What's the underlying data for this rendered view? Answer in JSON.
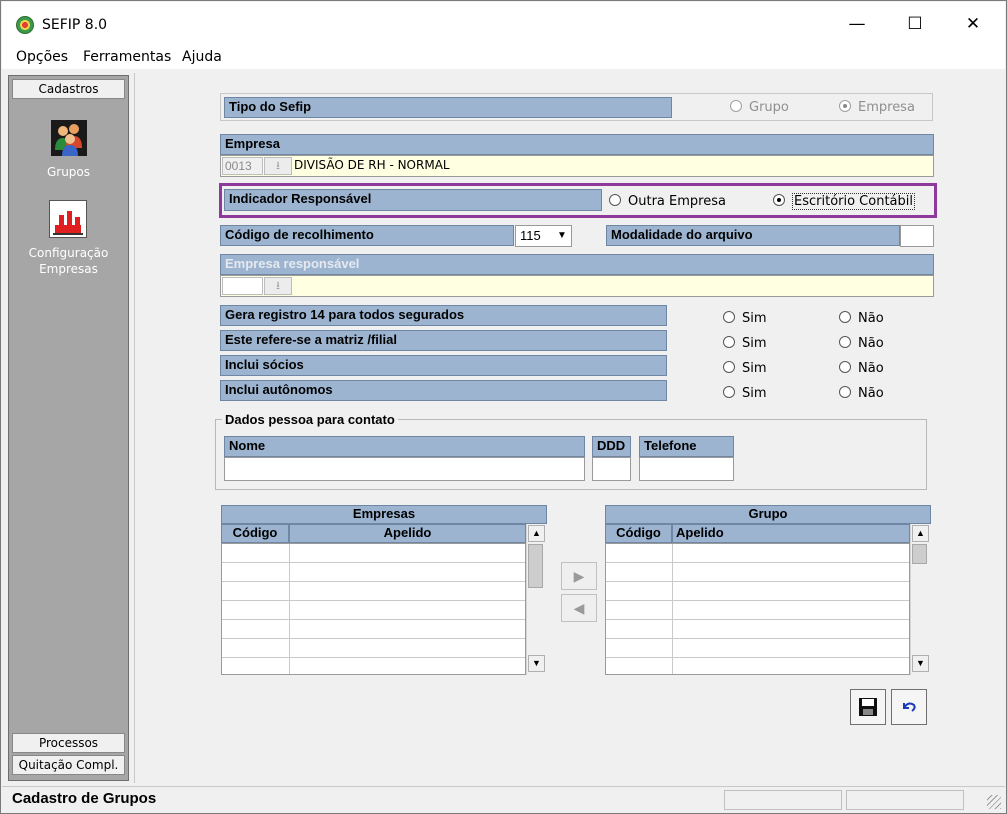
{
  "window": {
    "title": "SEFIP 8.0",
    "minimize_glyph": "—",
    "maximize_glyph": "☐",
    "close_glyph": "✕"
  },
  "menu": [
    "Opções",
    "Ferramentas",
    "Ajuda"
  ],
  "sidebar": {
    "top_tab": "Cadastros",
    "items": [
      {
        "label": "Grupos",
        "icon": "users-group-icon"
      },
      {
        "label_line1": "Configuração",
        "label_line2": "Empresas",
        "icon": "factory-icon"
      }
    ],
    "bottom_tabs": [
      "Processos",
      "Quitação Compl."
    ]
  },
  "form": {
    "tipo_sefip": {
      "label": "Tipo do Sefip",
      "options": [
        {
          "label": "Grupo",
          "selected": false
        },
        {
          "label": "Empresa",
          "selected": true
        }
      ]
    },
    "empresa": {
      "label": "Empresa",
      "code": "0013",
      "name": "DIVISÃO DE RH - NORMAL"
    },
    "indicador_responsavel": {
      "label": "Indicador Responsável",
      "options": [
        {
          "label": "Outra Empresa",
          "selected": false
        },
        {
          "label": "Escritório Contábil",
          "selected": true
        }
      ],
      "highlight_color": "#8e3a9d"
    },
    "codigo_recolhimento": {
      "label": "Código de recolhimento",
      "value": "115"
    },
    "modalidade": {
      "label": "Modalidade do arquivo",
      "value": ""
    },
    "empresa_responsavel": {
      "label": "Empresa responsável",
      "code": "",
      "name": ""
    },
    "questions": [
      {
        "label": "Gera registro 14 para todos segurados",
        "yes": "Sim",
        "no": "Não"
      },
      {
        "label": "Este refere-se a matriz /filial",
        "yes": "Sim",
        "no": "Não"
      },
      {
        "label": "Inclui sócios",
        "yes": "Sim",
        "no": "Não"
      },
      {
        "label": "Inclui autônomos",
        "yes": "Sim",
        "no": "Não"
      }
    ],
    "contato": {
      "group_label": "Dados pessoa para contato",
      "nome_label": "Nome",
      "ddd_label": "DDD",
      "telefone_label": "Telefone",
      "nome": "",
      "ddd": "",
      "telefone": ""
    }
  },
  "grids": {
    "empresas": {
      "title": "Empresas",
      "columns": [
        "Código",
        "Apelido"
      ],
      "rows": []
    },
    "grupo": {
      "title": "Grupo",
      "columns": [
        "Código",
        "Apelido"
      ],
      "rows": []
    }
  },
  "buttons": {
    "add_arrow": "▶",
    "remove_arrow": "◀",
    "save_icon": "floppy-disk-icon",
    "undo_icon": "undo-icon"
  },
  "status": {
    "text": "Cadastro de Grupos"
  },
  "colors": {
    "header_blue": "#9cb4d0",
    "field_yellow": "#ffffe1",
    "sidebar_gray": "#a6a6a6",
    "highlight_purple": "#8e3a9d"
  }
}
